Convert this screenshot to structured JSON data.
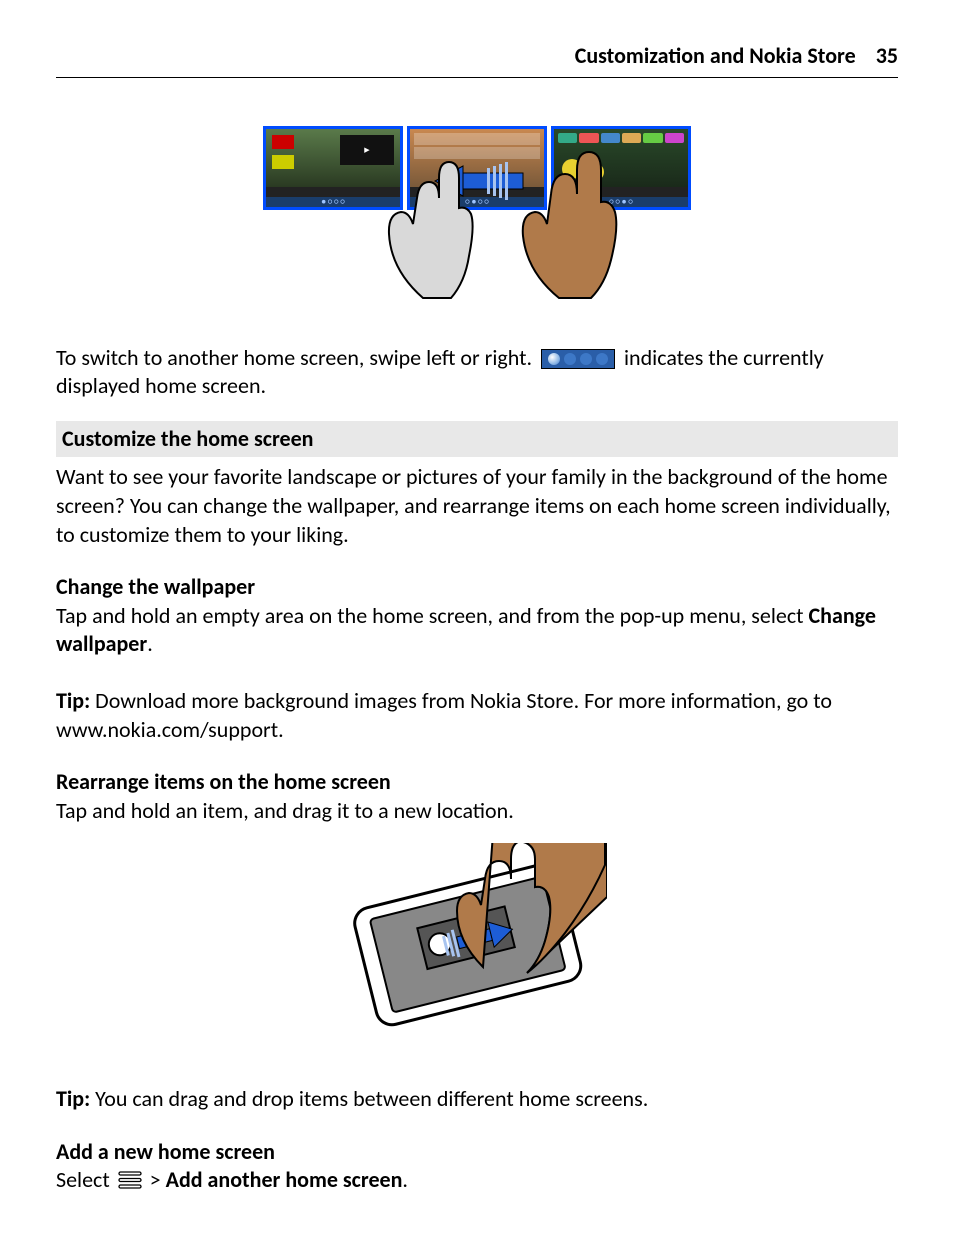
{
  "header": {
    "title": "Customization and Nokia Store",
    "page": "35"
  },
  "body": {
    "switch_line_pre": "To switch to another home screen, swipe left or right. ",
    "switch_line_post": " indicates the currently displayed home screen.",
    "section_customize": "Customize the home screen",
    "customize_para": "Want to see your favorite landscape or pictures of your family in the background of the home screen? You can change the wallpaper, and rearrange items on each home screen individually, to customize them to your liking.",
    "sub_wallpaper": "Change the wallpaper",
    "wallpaper_para_pre": "Tap and hold an empty area on the home screen, and from the pop-up menu, select ",
    "wallpaper_para_bold": "Change wallpaper",
    "wallpaper_para_post": ".",
    "tip1_label": "Tip: ",
    "tip1_text": "Download more background images from Nokia Store. For more information, go to www.nokia.com/support.",
    "sub_rearrange": "Rearrange items on the home screen",
    "rearrange_para": "Tap and hold an item, and drag it to a new location.",
    "tip2_label": "Tip: ",
    "tip2_text": "You can drag and drop items between different home screens.",
    "sub_add": "Add a new home screen",
    "add_line_pre": "Select ",
    "add_line_mid": " > ",
    "add_line_bold": "Add another home screen",
    "add_line_post": "."
  }
}
